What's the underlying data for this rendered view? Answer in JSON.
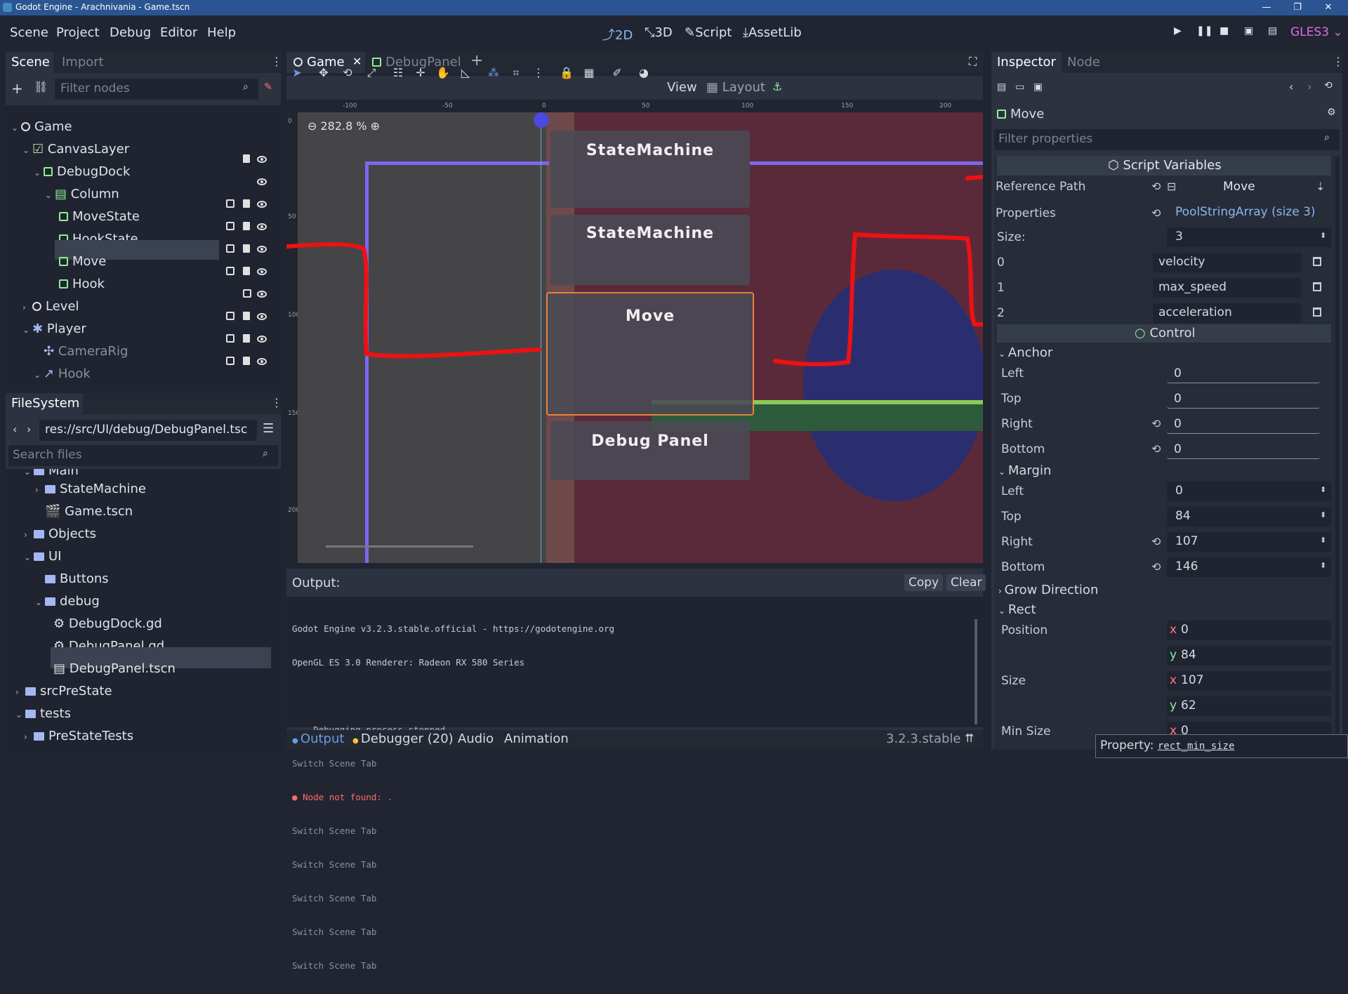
{
  "window": {
    "title": "Godot Engine - Arachnivania - Game.tscn",
    "controls": [
      "—",
      "❐",
      "✕"
    ]
  },
  "menu": [
    "Scene",
    "Project",
    "Debug",
    "Editor",
    "Help"
  ],
  "main_modes": [
    "2D",
    "3D",
    "Script",
    "AssetLib"
  ],
  "renderer": "GLES3",
  "scene_dock": {
    "tabs": [
      "Scene",
      "Import"
    ],
    "filter_placeholder": "Filter nodes",
    "nodes": [
      {
        "label": "Game",
        "icon": "node2d-icon"
      },
      {
        "label": "CanvasLayer",
        "icon": "canvaslayer-icon"
      },
      {
        "label": "DebugDock",
        "icon": "control-icon"
      },
      {
        "label": "Column",
        "icon": "vbox-icon"
      },
      {
        "label": "MoveState",
        "icon": "control-icon"
      },
      {
        "label": "HookState",
        "icon": "control-icon"
      },
      {
        "label": "Move",
        "icon": "control-icon"
      },
      {
        "label": "Hook",
        "icon": "control-icon"
      },
      {
        "label": "Level",
        "icon": "node2d-icon"
      },
      {
        "label": "Player",
        "icon": "kinematic-icon"
      },
      {
        "label": "CameraRig",
        "icon": "position2d-icon"
      },
      {
        "label": "Hook",
        "icon": "hook-icon"
      }
    ]
  },
  "filesystem": {
    "title": "FileSystem",
    "path": "res://src/UI/debug/DebugPanel.tsc",
    "search_placeholder": "Search files",
    "items": [
      {
        "label": "Main",
        "type": "folder"
      },
      {
        "label": "StateMachine",
        "type": "folder"
      },
      {
        "label": "Game.tscn",
        "type": "scene"
      },
      {
        "label": "Objects",
        "type": "folder"
      },
      {
        "label": "UI",
        "type": "folder"
      },
      {
        "label": "Buttons",
        "type": "folder"
      },
      {
        "label": "debug",
        "type": "folder"
      },
      {
        "label": "DebugDock.gd",
        "type": "script"
      },
      {
        "label": "DebugPanel.gd",
        "type": "script"
      },
      {
        "label": "DebugPanel.tscn",
        "type": "scene"
      },
      {
        "label": "srcPreState",
        "type": "folder"
      },
      {
        "label": "tests",
        "type": "folder"
      },
      {
        "label": "PreStateTests",
        "type": "folder"
      }
    ]
  },
  "editor_tabs": [
    "Game",
    "DebugPanel"
  ],
  "toolbar": {
    "view": "View",
    "layout": "Layout"
  },
  "viewport": {
    "zoom": "282.8 %",
    "ruler_ticks": [
      "-100",
      "-50",
      "0",
      "50",
      "100",
      "150",
      "200"
    ],
    "ruler_v_ticks": [
      "0",
      "50",
      "100",
      "150",
      "200"
    ],
    "labels": [
      "StateMachine",
      "StateMachine",
      "Move",
      "Debug Panel"
    ]
  },
  "output": {
    "title": "Output:",
    "copy": "Copy",
    "clear": "Clear",
    "lines": [
      "Godot Engine v3.2.3.stable.official - https://godotengine.org",
      "OpenGL ES 3.0 Renderer: Radeon RX 580 Series",
      "",
      "--- Debugging process stopped ---",
      "Switch Scene Tab",
      "Node not found: .",
      "Switch Scene Tab",
      "Switch Scene Tab",
      "Switch Scene Tab",
      "Switch Scene Tab",
      "Switch Scene Tab"
    ],
    "bottom_tabs": [
      "Output",
      "Debugger (20)",
      "Audio",
      "Animation"
    ],
    "version": "3.2.3.stable"
  },
  "inspector": {
    "tabs": [
      "Inspector",
      "Node"
    ],
    "object": "Move",
    "filter_placeholder": "Filter properties",
    "script_variables": "Script Variables",
    "reference_path_label": "Reference Path",
    "reference_path_value": "Move",
    "properties_label": "Properties",
    "properties_value": "PoolStringArray (size 3)",
    "size_label": "Size:",
    "size_value": "3",
    "array": [
      {
        "index": "0",
        "value": "velocity"
      },
      {
        "index": "1",
        "value": "max_speed"
      },
      {
        "index": "2",
        "value": "acceleration"
      }
    ],
    "control": "Control",
    "anchor": "Anchor",
    "anchor_rows": [
      {
        "label": "Left",
        "value": "0"
      },
      {
        "label": "Top",
        "value": "0"
      },
      {
        "label": "Right",
        "value": "0"
      },
      {
        "label": "Bottom",
        "value": "0"
      }
    ],
    "margin": "Margin",
    "margin_rows": [
      {
        "label": "Left",
        "value": "0"
      },
      {
        "label": "Top",
        "value": "84"
      },
      {
        "label": "Right",
        "value": "107"
      },
      {
        "label": "Bottom",
        "value": "146"
      }
    ],
    "grow_direction": "Grow Direction",
    "rect": "Rect",
    "position_label": "Position",
    "position_x": "0",
    "position_y": "84",
    "size2_label": "Size",
    "size_x": "107",
    "size_y": "62",
    "min_size_label": "Min Size",
    "min_size_x": "0",
    "axis_x": "x",
    "axis_y": "y",
    "tooltip_prefix": "Property:",
    "tooltip_value": "rect_min_size"
  },
  "colors": {
    "accent": "#699ce8",
    "control_green": "#8eef97",
    "error": "#ff5d5d"
  }
}
